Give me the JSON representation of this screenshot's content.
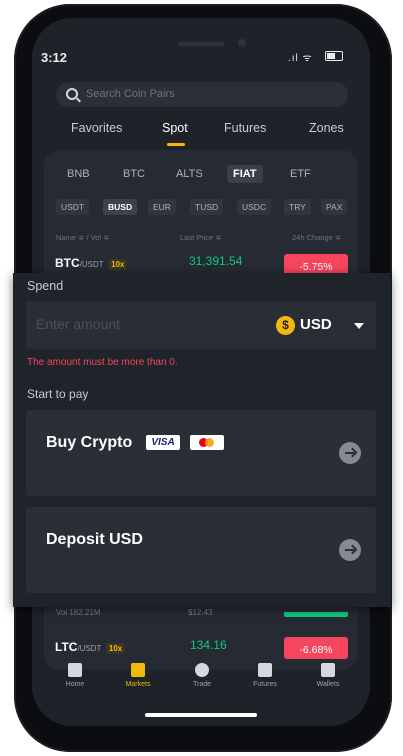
{
  "status_bar": {
    "time": "3:12"
  },
  "search": {
    "placeholder": "Search Coin Pairs"
  },
  "top_tabs": [
    "Favorites",
    "Spot",
    "Futures",
    "Zones"
  ],
  "sub_tabs": [
    "BNB",
    "BTC",
    "ALTS",
    "FIAT",
    "ETF"
  ],
  "quote_chips": [
    "USDT",
    "BUSD",
    "EUR",
    "TUSD",
    "USDC",
    "TRY",
    "PAX"
  ],
  "columns": {
    "name": "Name ≑ / Vol ≑",
    "price": "Last Price ≑",
    "change": "24h Change ≑"
  },
  "rows": [
    {
      "base": "BTC",
      "quote": "/USDT",
      "leverage": "10x",
      "price": "31,391.54",
      "change": "-5.75%"
    },
    {
      "base": "LTC",
      "quote": "/USDT",
      "leverage": "10x",
      "price": "134.16",
      "change": "-6.68%"
    }
  ],
  "partial_row": {
    "vol": "Vol 182.21M",
    "price": "$12.43"
  },
  "bottom_nav": [
    "Home",
    "Markets",
    "Trade",
    "Futures",
    "Wallets"
  ],
  "modal": {
    "spend_label": "Spend",
    "amount_placeholder": "Enter amount",
    "currency": "USD",
    "currency_symbol": "$",
    "error": "The amount must be more than 0.",
    "start_label": "Start to pay",
    "buy_title": "Buy Crypto",
    "visa": "VISA",
    "deposit_title": "Deposit USD"
  },
  "colors": {
    "accent": "#f0b90b",
    "up": "#0ecb81",
    "down": "#f6465d"
  }
}
